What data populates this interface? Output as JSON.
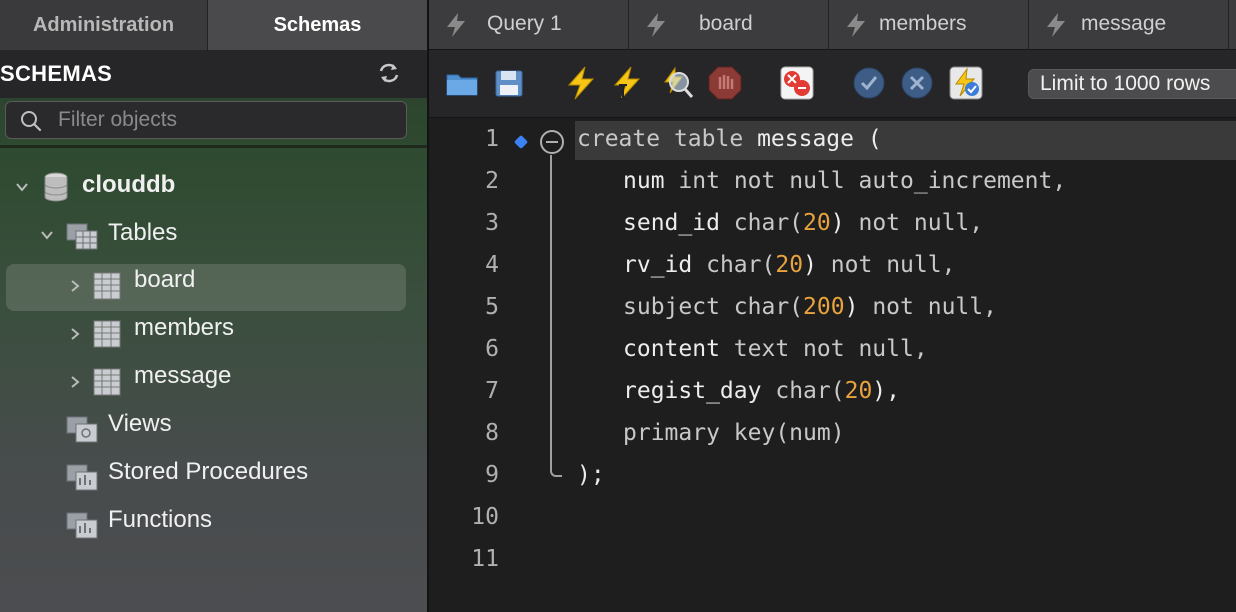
{
  "left_tabs": {
    "administration": "Administration",
    "schemas": "Schemas"
  },
  "schemas_panel": {
    "title": "SCHEMAS",
    "filter_placeholder": "Filter objects",
    "tree": {
      "schema": "clouddb",
      "tables_label": "Tables",
      "tables": [
        "board",
        "members",
        "message"
      ],
      "views_label": "Views",
      "procedures_label": "Stored Procedures",
      "functions_label": "Functions"
    }
  },
  "query_tabs": [
    "Query 1",
    "board",
    "members",
    "message"
  ],
  "toolbar": {
    "limit_label": "Limit to 1000 rows"
  },
  "editor": {
    "line_numbers": [
      "1",
      "2",
      "3",
      "4",
      "5",
      "6",
      "7",
      "8",
      "9",
      "10",
      "11"
    ],
    "lines": {
      "l1": {
        "a": "create",
        "b": "table",
        "c": "message ("
      },
      "l2": {
        "a": "num",
        "b": "int",
        "c": "not",
        "d": "null",
        "e": "auto_increment,"
      },
      "l3": {
        "a": "send_id",
        "b": "char(",
        "n": "20",
        "c": ")",
        "d": "not",
        "e": "null,"
      },
      "l4": {
        "a": "rv_id",
        "b": "char(",
        "n": "20",
        "c": ")",
        "d": "not",
        "e": "null,"
      },
      "l5": {
        "a": "subject",
        "b": "char(",
        "n": "200",
        "c": ")",
        "d": "not",
        "e": "null,"
      },
      "l6": {
        "a": "content",
        "b": "text",
        "d": "not",
        "e": "null,"
      },
      "l7": {
        "a": "regist_day",
        "b": "char(",
        "n": "20",
        "c": "),"
      },
      "l8": {
        "a": "primary",
        "b": "key(num)"
      },
      "l9": {
        "a": ");"
      }
    }
  },
  "colors": {
    "number": "#e8a33d",
    "accent_blue": "#3b82f6",
    "selection_row": "#3a3a3a"
  }
}
